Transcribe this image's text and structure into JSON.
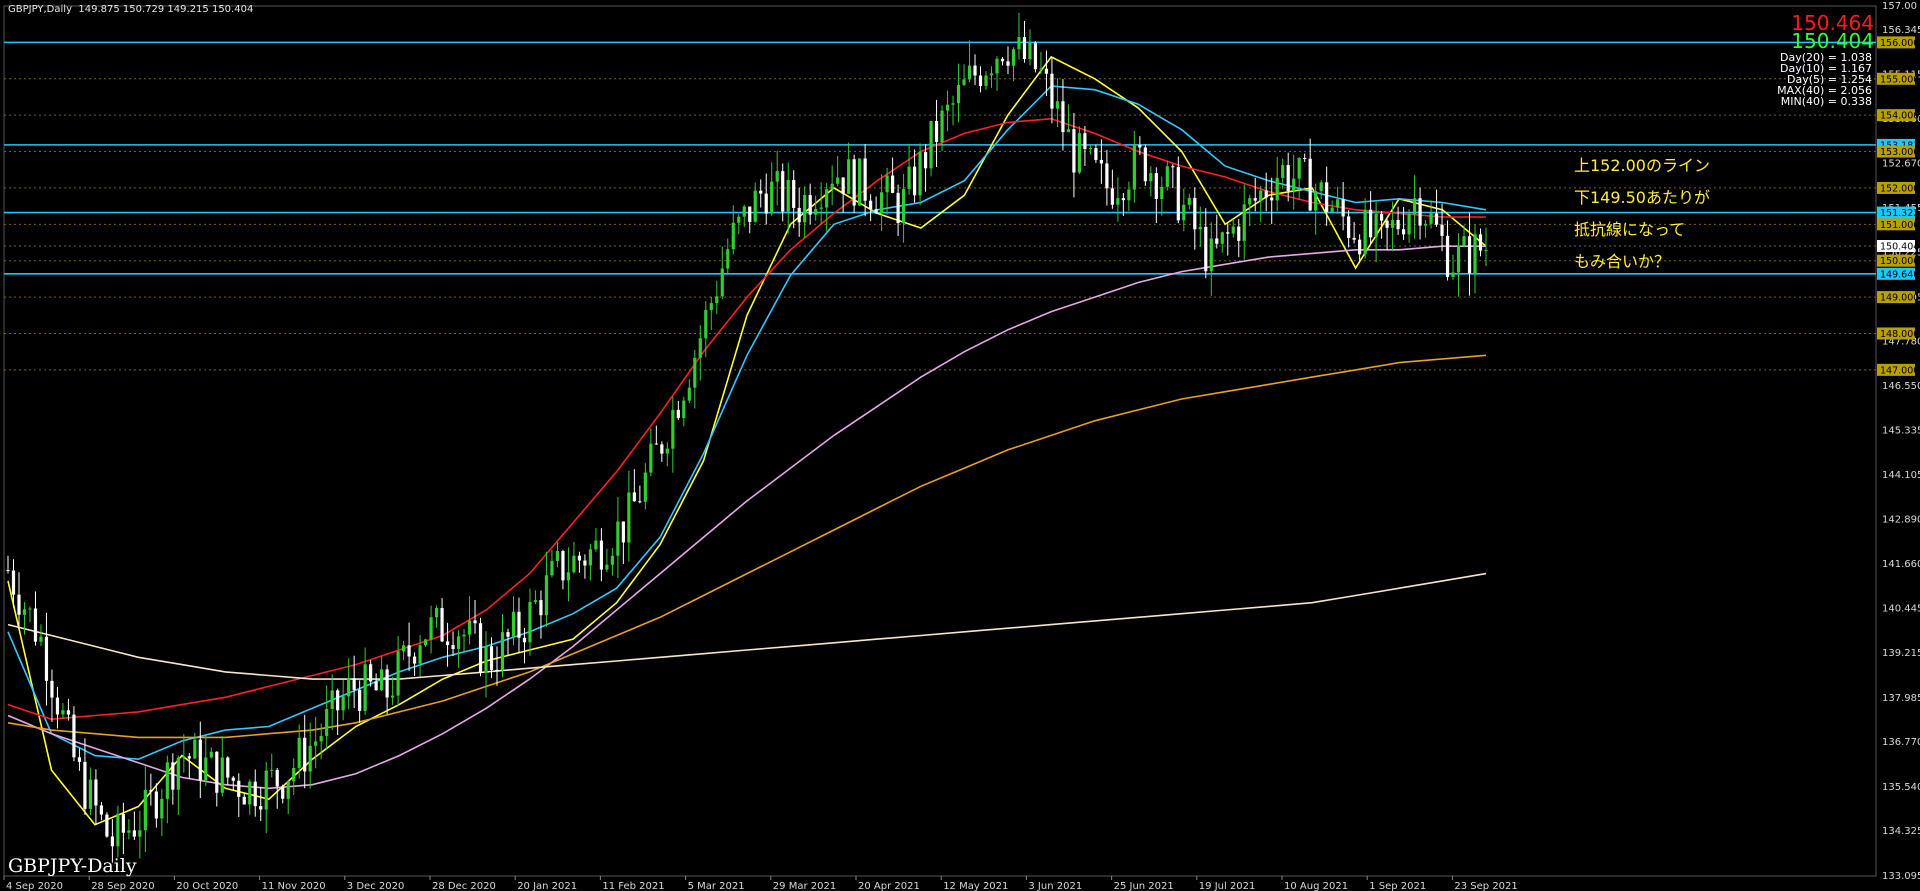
{
  "header": {
    "symbol": "GBPJPY,Daily",
    "ohlc": "149.875 150.729 149.215 150.404"
  },
  "prices": {
    "bid": "150.464",
    "ask": "150.404"
  },
  "stats": [
    "Day(20) = 1.038",
    "Day(10) = 1.167",
    "Day(5) = 1.254",
    "MAX(40) = 2.056",
    "MIN(40) = 0.338"
  ],
  "watermark": "GBPJPY-Daily",
  "annotations": [
    "上152.00のライン",
    "下149.50あたりが",
    "抵抗線になって",
    "もみ合いか？"
  ],
  "colors": {
    "background": "#000000",
    "bull_candle": "#33cc33",
    "bear_candle": "#ffffff",
    "hline": "#1ec8ff",
    "grid": "#444444",
    "sma_fast": "#ffff33",
    "sma_mid": "#33c8ff",
    "sma_red": "#ff2020",
    "sma_pink": "#e6a8e6",
    "sma_orange": "#e8a020",
    "sma_cream": "#f5e6c8"
  },
  "chart_data": {
    "type": "candlestick",
    "symbol": "GBPJPY",
    "timeframe": "Daily",
    "ylim": [
      133.09,
      157.0
    ],
    "x_ticks": [
      "4 Sep 2020",
      "28 Sep 2020",
      "20 Oct 2020",
      "11 Nov 2020",
      "3 Dec 2020",
      "28 Dec 2020",
      "20 Jan 2021",
      "11 Feb 2021",
      "5 Mar 2021",
      "29 Mar 2021",
      "20 Apr 2021",
      "12 May 2021",
      "3 Jun 2021",
      "25 Jun 2021",
      "19 Jul 2021",
      "10 Aug 2021",
      "1 Sep 2021",
      "23 Sep 2021"
    ],
    "y_ticks": [
      157.0,
      156.345,
      155.115,
      153.9,
      152.67,
      151.455,
      150.225,
      148.995,
      147.78,
      146.55,
      145.335,
      144.105,
      142.89,
      141.66,
      140.445,
      139.215,
      137.985,
      136.77,
      135.54,
      134.325,
      133.095
    ],
    "y_tick_labels": [
      "157.00",
      "156.345",
      "155.115",
      "153.900",
      "152.670",
      "151.455",
      "150.225",
      "148.995",
      "147.780",
      "146.550",
      "145.335",
      "144.105",
      "142.890",
      "141.660",
      "140.445",
      "139.215",
      "137.985",
      "136.770",
      "135.540",
      "134.325",
      "133.095"
    ],
    "horizontal_lines": [
      {
        "price": 156.0,
        "label": "156.000",
        "color": "#1ec8ff",
        "tag_bg": "#b8a000",
        "tag_fg": "#000000"
      },
      {
        "price": 155.0,
        "label": "155.000",
        "color": "#806000",
        "tag_bg": "#b8a000",
        "tag_fg": "#000000"
      },
      {
        "price": 154.0,
        "label": "154.000",
        "color": "#806000",
        "tag_bg": "#b8a000",
        "tag_fg": "#000000"
      },
      {
        "price": 153.183,
        "label": "153.183",
        "color": "#1ec8ff",
        "tag_bg": "#1ec8ff",
        "tag_fg": "#000000"
      },
      {
        "price": 153.0,
        "label": "153.000",
        "color": "#806000",
        "tag_bg": "#b8a000",
        "tag_fg": "#000000"
      },
      {
        "price": 152.0,
        "label": "152.000",
        "color": "#806000",
        "tag_bg": "#b8a000",
        "tag_fg": "#000000"
      },
      {
        "price": 151.322,
        "label": "151.322",
        "color": "#1ec8ff",
        "tag_bg": "#1ec8ff",
        "tag_fg": "#000000"
      },
      {
        "price": 151.0,
        "label": "151.000",
        "color": "#806000",
        "tag_bg": "#b8a000",
        "tag_fg": "#000000"
      },
      {
        "price": 150.404,
        "label": "150.404",
        "color": "#666666",
        "tag_bg": "#ffffff",
        "tag_fg": "#000000"
      },
      {
        "price": 150.0,
        "label": "150.000",
        "color": "#806000",
        "tag_bg": "#b8a000",
        "tag_fg": "#000000"
      },
      {
        "price": 149.64,
        "label": "149.640",
        "color": "#1ec8ff",
        "tag_bg": "#1ec8ff",
        "tag_fg": "#000000"
      },
      {
        "price": 149.0,
        "label": "149.000",
        "color": "#806000",
        "tag_bg": "#b8a000",
        "tag_fg": "#000000"
      },
      {
        "price": 148.0,
        "label": "148.000",
        "color": "#806000",
        "tag_bg": "#b8a000",
        "tag_fg": "#000000"
      },
      {
        "price": 147.0,
        "label": "147.000",
        "color": "#806000",
        "tag_bg": "#b8a000",
        "tag_fg": "#000000"
      }
    ],
    "moving_averages": [
      {
        "name": "fast",
        "color": "#ffff33",
        "values": [
          141.2,
          136.0,
          134.5,
          135.0,
          136.4,
          135.5,
          135.2,
          136.3,
          137.2,
          137.8,
          138.5,
          139.0,
          139.3,
          139.6,
          140.6,
          142.2,
          144.5,
          148.5,
          151.0,
          152.0,
          151.3,
          150.9,
          151.8,
          154.0,
          155.6,
          155.0,
          154.2,
          153.0,
          151.0,
          151.8,
          152.0,
          149.8,
          151.7,
          151.4,
          150.4
        ]
      },
      {
        "name": "mid",
        "color": "#33c8ff",
        "values": [
          139.8,
          137.0,
          136.4,
          136.3,
          136.8,
          137.1,
          137.2,
          137.7,
          138.2,
          138.7,
          139.1,
          139.4,
          139.8,
          140.3,
          141.0,
          142.4,
          144.7,
          147.4,
          149.6,
          151.0,
          151.4,
          151.6,
          152.2,
          153.6,
          154.8,
          154.7,
          154.3,
          153.6,
          152.6,
          152.2,
          151.9,
          151.6,
          151.7,
          151.6,
          151.4
        ]
      },
      {
        "name": "red",
        "color": "#ff2020",
        "values": [
          137.8,
          137.4,
          137.5,
          137.6,
          137.8,
          138.0,
          138.3,
          138.6,
          138.9,
          139.3,
          139.7,
          140.4,
          141.4,
          142.8,
          144.2,
          145.8,
          147.5,
          149.0,
          150.3,
          151.3,
          152.2,
          153.0,
          153.5,
          153.8,
          153.9,
          153.5,
          153.0,
          152.6,
          152.3,
          151.9,
          151.6,
          151.4,
          151.3,
          151.2,
          151.2
        ]
      },
      {
        "name": "pink",
        "color": "#e6a8e6",
        "values": [
          137.5,
          137.0,
          136.6,
          136.2,
          135.8,
          135.6,
          135.5,
          135.6,
          135.9,
          136.4,
          137.0,
          137.7,
          138.5,
          139.4,
          140.4,
          141.4,
          142.4,
          143.4,
          144.3,
          145.2,
          146.0,
          146.8,
          147.5,
          148.1,
          148.6,
          149.0,
          149.4,
          149.7,
          149.9,
          150.1,
          150.2,
          150.3,
          150.3,
          150.4,
          150.4
        ]
      },
      {
        "name": "orange",
        "color": "#e8a020",
        "values": [
          137.3,
          137.1,
          137.0,
          136.9,
          136.9,
          136.9,
          137.0,
          137.1,
          137.3,
          137.6,
          137.9,
          138.3,
          138.7,
          139.2,
          139.7,
          140.2,
          140.8,
          141.4,
          142.0,
          142.6,
          143.2,
          143.8,
          144.3,
          144.8,
          145.2,
          145.6,
          145.9,
          146.2,
          146.4,
          146.6,
          146.8,
          147.0,
          147.2,
          147.3,
          147.4
        ]
      },
      {
        "name": "cream",
        "color": "#f5e6c8",
        "values": [
          140.0,
          139.7,
          139.4,
          139.1,
          138.9,
          138.7,
          138.6,
          138.5,
          138.5,
          138.5,
          138.6,
          138.7,
          138.8,
          138.9,
          139.0,
          139.1,
          139.2,
          139.3,
          139.4,
          139.5,
          139.6,
          139.7,
          139.8,
          139.9,
          140.0,
          140.1,
          140.2,
          140.3,
          140.4,
          140.5,
          140.6,
          140.8,
          141.0,
          141.2,
          141.4
        ]
      }
    ],
    "close_path": [
      141.5,
      139.5,
      136.0,
      134.0,
      134.8,
      136.5,
      136.0,
      135.5,
      135.8,
      136.9,
      138.3,
      138.1,
      139.8,
      140.0,
      139.0,
      140.0,
      141.5,
      142.0,
      142.8,
      145.0,
      147.5,
      150.5,
      152.0,
      151.5,
      152.5,
      152.0,
      151.5,
      153.5,
      155.0,
      156.0,
      155.2,
      153.0,
      152.0,
      152.8,
      151.8,
      150.0,
      151.3,
      152.5,
      152.0,
      151.0,
      150.5,
      151.8,
      150.0,
      150.4
    ]
  }
}
